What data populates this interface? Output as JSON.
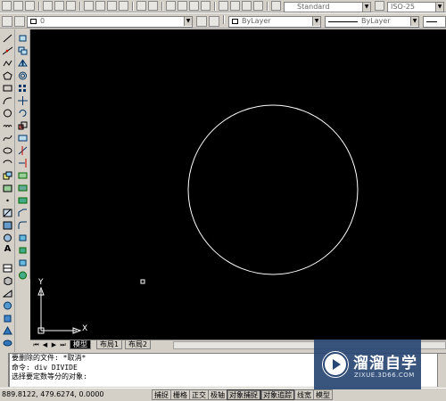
{
  "toolbar": {
    "style_value": "Standard",
    "layer_value": "0",
    "color_value": "ByLayer",
    "linetype_value": "ByLayer",
    "dimstyle_value": "ISO-25"
  },
  "canvas": {
    "ucs_y_label": "Y",
    "ucs_x_label": "X"
  },
  "layout_tabs": {
    "model": "模型",
    "layout1": "布局1",
    "layout2": "布局2"
  },
  "command_window": {
    "lines": [
      "要删除的文件: *取消*",
      "命令: div DIVIDE",
      "选择要定数等分的对象:"
    ]
  },
  "status_bar": {
    "coordinates": "889.8122,  479.6274, 0.0000",
    "buttons": [
      "捕捉",
      "栅格",
      "正交",
      "极轴",
      "对象捕捉",
      "对象追踪",
      "线宽",
      "模型"
    ]
  },
  "watermark": {
    "title": "溜溜自学",
    "subtitle": "ZIXUE.3D66.COM"
  },
  "colors": {
    "canvas_background": "#000000",
    "drawing_line": "#ffffff",
    "ui_face": "#d4d0c8",
    "watermark_bg": "#284673"
  }
}
